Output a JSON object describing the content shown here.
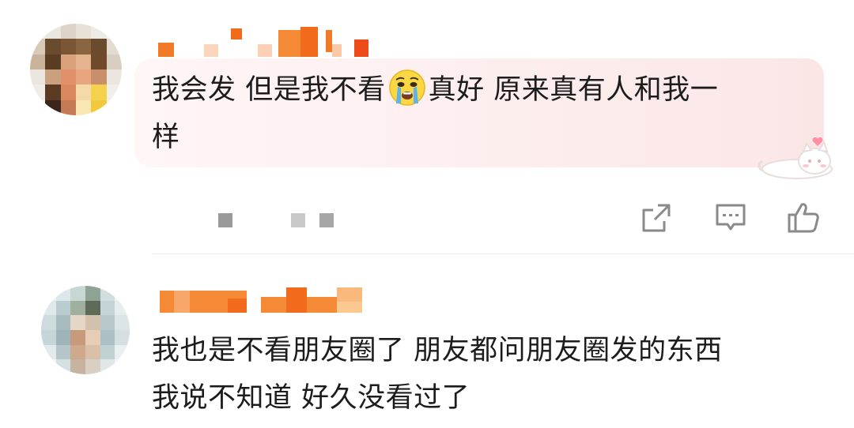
{
  "comments": [
    {
      "text_line1": "我会发 但是我不看",
      "emoji": "crying-face-emoji",
      "text_line1_rest": "真好 原来真有人和我一",
      "text_line2": "样",
      "actions": [
        "share-icon",
        "reply-icon",
        "like-icon"
      ]
    },
    {
      "text_line1": "我也是不看朋友圈了 朋友都问朋友圈发的东西",
      "text_line2": "我说不知道 好久没看过了"
    }
  ],
  "colors": {
    "accent": "#f26b1d",
    "text": "#1c1c1c",
    "icon": "#8a8a8a",
    "bubble": "#fdeeee"
  }
}
